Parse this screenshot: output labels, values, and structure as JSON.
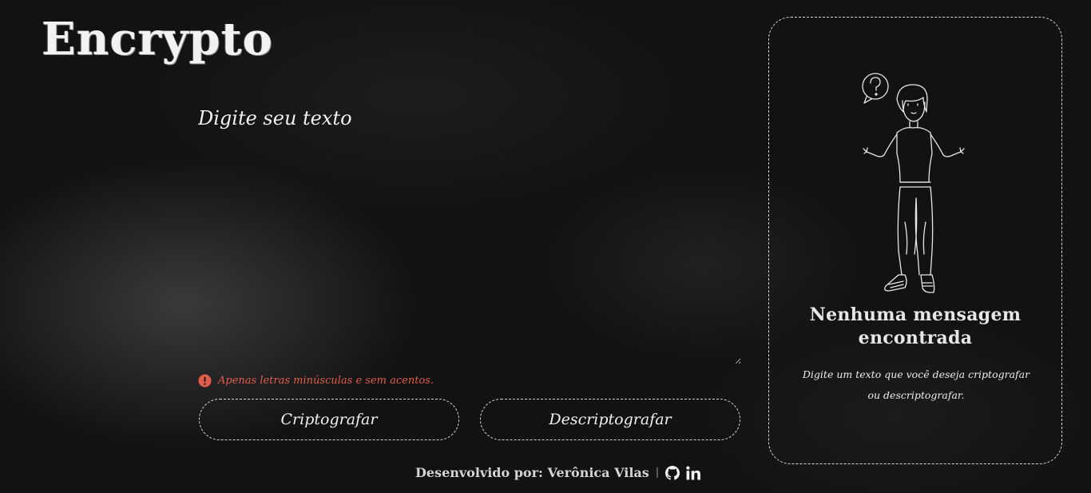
{
  "header": {
    "logo": "Encrypto"
  },
  "input": {
    "placeholder": "Digite seu texto",
    "value": ""
  },
  "warning": {
    "icon": "exclamation-circle-icon",
    "text": "Apenas letras minúsculas e sem acentos.",
    "color": "#e25c4b"
  },
  "actions": {
    "encrypt_label": "Criptografar",
    "decrypt_label": "Descriptografar"
  },
  "result_panel": {
    "illustration": "confused-person-question-mark",
    "title": "Nenhuma mensagem encontrada",
    "description": "Digite um texto que você deseja criptografar ou descriptografar."
  },
  "footer": {
    "credit": "Desenvolvido por: Verônica Vilas",
    "separator": "|",
    "links": [
      {
        "icon": "github-icon"
      },
      {
        "icon": "linkedin-icon"
      }
    ]
  },
  "colors": {
    "background": "#121212",
    "chalk": "#f0f0f0",
    "warning": "#e25c4b"
  }
}
